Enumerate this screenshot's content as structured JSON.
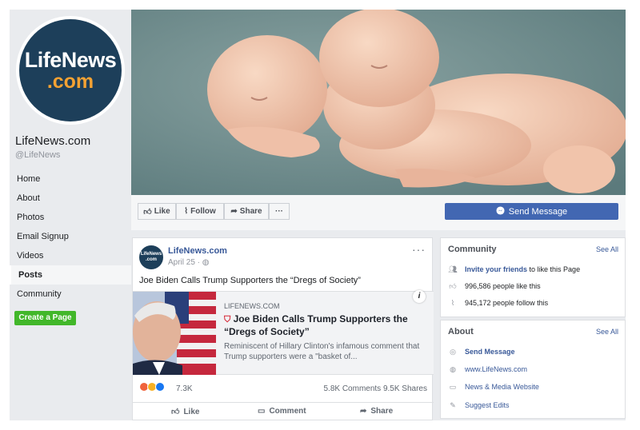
{
  "page": {
    "logo_line1": "LifeNews",
    "logo_line2": ".com",
    "name": "LifeNews.com",
    "handle": "@LifeNews"
  },
  "nav": {
    "items": [
      "Home",
      "About",
      "Photos",
      "Email Signup",
      "Videos",
      "Posts",
      "Community"
    ],
    "active": "Posts",
    "create_page_label": "Create a Page"
  },
  "actions": {
    "like_label": "Like",
    "follow_label": "Follow",
    "share_label": "Share",
    "more_label": "···",
    "send_message_label": "Send Message"
  },
  "post": {
    "avatar_text": "LifeNews .com",
    "author": "LifeNews.com",
    "date": "April 25 · ",
    "more": "···",
    "text": "Joe Biden Calls Trump Supporters the “Dregs of Society”",
    "link_domain": "LIFENEWS.COM",
    "link_title": "Joe Biden Calls Trump Supporters the “Dregs of Society”",
    "link_desc": "Reminiscent of Hillary Clinton's infamous comment that Trump supporters were a \"basket of...",
    "info_label": "i",
    "reaction_count": "7.3K",
    "comments_shares": "5.8K Comments  9.5K Shares",
    "like_label": "Like",
    "comment_label": "Comment",
    "share_label": "Share"
  },
  "community": {
    "title": "Community",
    "see_all": "See All",
    "invite_link": "Invite your friends",
    "invite_rest": " to like this Page",
    "likes": "996,586 people like this",
    "follows": "945,172 people follow this"
  },
  "about": {
    "title": "About",
    "see_all": "See All",
    "send_message": "Send Message",
    "website": "www.LifeNews.com",
    "category": "News & Media Website",
    "suggest": "Suggest Edits"
  },
  "colors": {
    "brand_navy": "#1d3f5a",
    "brand_orange": "#f4a233",
    "facebook_blue": "#4267b2",
    "create_green": "#42b72a"
  }
}
